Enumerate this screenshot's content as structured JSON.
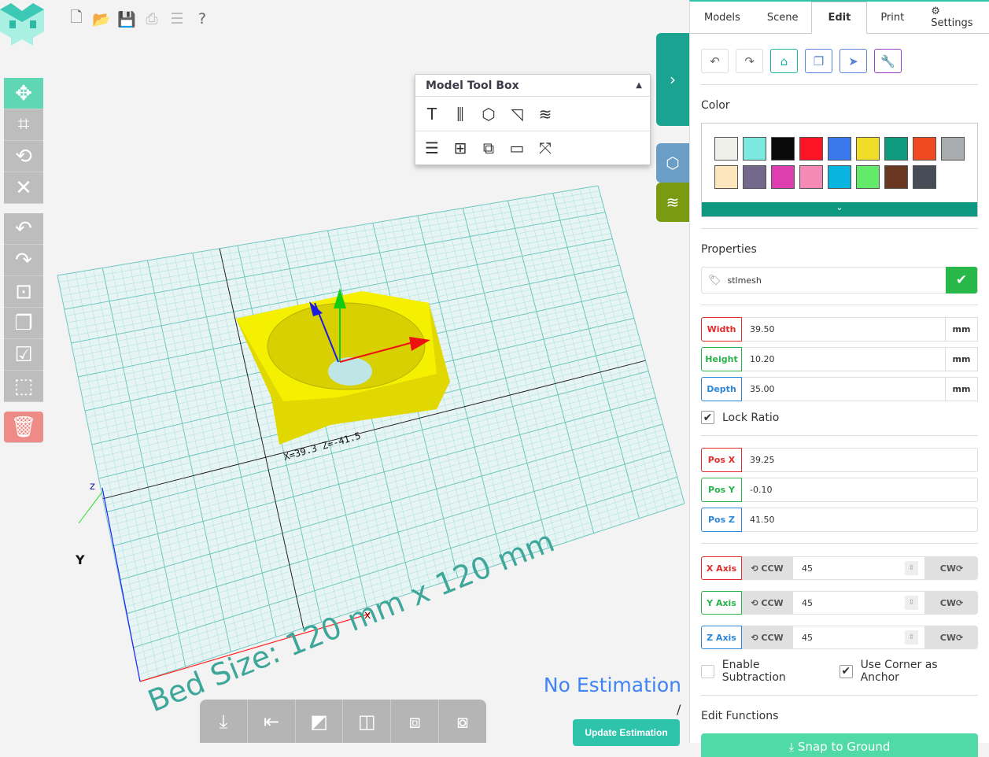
{
  "file_toolbar": [
    {
      "icon": "new-file-icon",
      "glyph": "🗋"
    },
    {
      "icon": "open-folder-icon",
      "glyph": "📂"
    },
    {
      "icon": "save-icon",
      "glyph": "💾"
    },
    {
      "icon": "print-icon",
      "glyph": "⎙"
    },
    {
      "icon": "sliders-icon",
      "glyph": "☰"
    },
    {
      "icon": "help-icon",
      "glyph": "?"
    }
  ],
  "left_tools": [
    {
      "name": "move",
      "glyph": "✥"
    },
    {
      "name": "crop",
      "glyph": "⌗"
    },
    {
      "name": "rotate",
      "glyph": "⟲"
    },
    {
      "name": "close",
      "glyph": "✕"
    }
  ],
  "left_tools2": [
    {
      "name": "undo",
      "glyph": "↶"
    },
    {
      "name": "redo",
      "glyph": "↷"
    },
    {
      "name": "center",
      "glyph": "⊡"
    },
    {
      "name": "copy",
      "glyph": "❐"
    },
    {
      "name": "select-check",
      "glyph": "☑"
    },
    {
      "name": "select-region",
      "glyph": "⬚"
    }
  ],
  "toolbox": {
    "title": "Model Tool Box",
    "row1": [
      {
        "name": "text",
        "glyph": "T"
      },
      {
        "name": "screw",
        "glyph": "⫼"
      },
      {
        "name": "cube",
        "glyph": "⬡"
      },
      {
        "name": "quarter-round",
        "glyph": "◹"
      },
      {
        "name": "layers",
        "glyph": "≋"
      }
    ],
    "row2": [
      {
        "name": "list",
        "glyph": "☰"
      },
      {
        "name": "center-grid",
        "glyph": "⊞"
      },
      {
        "name": "align",
        "glyph": "⧉"
      },
      {
        "name": "ruler",
        "glyph": "▭"
      },
      {
        "name": "expand",
        "glyph": "⤧"
      }
    ]
  },
  "viewport": {
    "bed_size": "Bed Size: 120 mm x 120 mm",
    "coord_label": "X=39.3 Z=-41.5",
    "axis_y": "Y",
    "axis_x": "x",
    "axis_z": "z"
  },
  "bottom_tools": [
    {
      "name": "drop-to-ground",
      "glyph": "⤓"
    },
    {
      "name": "align-ground",
      "glyph": "⇤"
    },
    {
      "name": "mirror",
      "glyph": "◩"
    },
    {
      "name": "align-center",
      "glyph": "◫"
    },
    {
      "name": "merge",
      "glyph": "⧈"
    },
    {
      "name": "split",
      "glyph": "⧇"
    }
  ],
  "estimation": {
    "text": "No Estimation",
    "slash": "/",
    "button": "Update Estimation"
  },
  "tabs": [
    {
      "label": "Models"
    },
    {
      "label": "Scene"
    },
    {
      "label": "Edit",
      "active": true
    },
    {
      "label": "Print"
    },
    {
      "label": "⚙ Settings"
    }
  ],
  "edit_icons": [
    {
      "name": "undo",
      "glyph": "↶",
      "color": "#666"
    },
    {
      "name": "redo",
      "glyph": "↷",
      "color": "#666"
    },
    {
      "name": "home",
      "glyph": "⌂",
      "color": "#1bb5a1"
    },
    {
      "name": "copy",
      "glyph": "❐",
      "color": "#5b83d6"
    },
    {
      "name": "pointer",
      "glyph": "➤",
      "color": "#5b83d6"
    },
    {
      "name": "wrench",
      "glyph": "🔧",
      "color": "#9c3fcf"
    }
  ],
  "color": {
    "title": "Color",
    "swatches": [
      "#f0f0ea",
      "#7de8e0",
      "#0a0a0a",
      "#ff1425",
      "#3a78ee",
      "#f2dc2a",
      "#0f9b7e",
      "#f04a22",
      "#a9acae",
      "#fde6bb",
      "#74678c",
      "#dd3fb1",
      "#f58ab6",
      "#08b4e0",
      "#63ea6a",
      "#6a3720",
      "#474d57"
    ]
  },
  "properties": {
    "title": "Properties",
    "name": "stlmesh"
  },
  "dimensions": [
    {
      "label": "Width",
      "value": "39.50",
      "unit": "mm",
      "color": "#e02c2c"
    },
    {
      "label": "Height",
      "value": "10.20",
      "unit": "mm",
      "color": "#28b34a"
    },
    {
      "label": "Depth",
      "value": "35.00",
      "unit": "mm",
      "color": "#2d86d8"
    }
  ],
  "lock_ratio": {
    "label": "Lock Ratio",
    "checked": true
  },
  "position": [
    {
      "label": "Pos X",
      "value": "39.25",
      "color": "#e02c2c"
    },
    {
      "label": "Pos Y",
      "value": "-0.10",
      "color": "#28b34a"
    },
    {
      "label": "Pos Z",
      "value": "41.50",
      "color": "#2d86d8"
    }
  ],
  "rotation": [
    {
      "label": "X Axis",
      "value": "45",
      "color": "#e02c2c"
    },
    {
      "label": "Y Axis",
      "value": "45",
      "color": "#28b34a"
    },
    {
      "label": "Z Axis",
      "value": "45",
      "color": "#2d86d8"
    }
  ],
  "rot_labels": {
    "ccw": "⟲ CCW",
    "cw": "CW⟳"
  },
  "enable_subtraction": {
    "label": "Enable Subtraction",
    "checked": false
  },
  "corner_anchor": {
    "label": "Use Corner as Anchor",
    "checked": true
  },
  "edit_functions": {
    "title": "Edit Functions",
    "snap": "⤓ Snap to Ground"
  }
}
